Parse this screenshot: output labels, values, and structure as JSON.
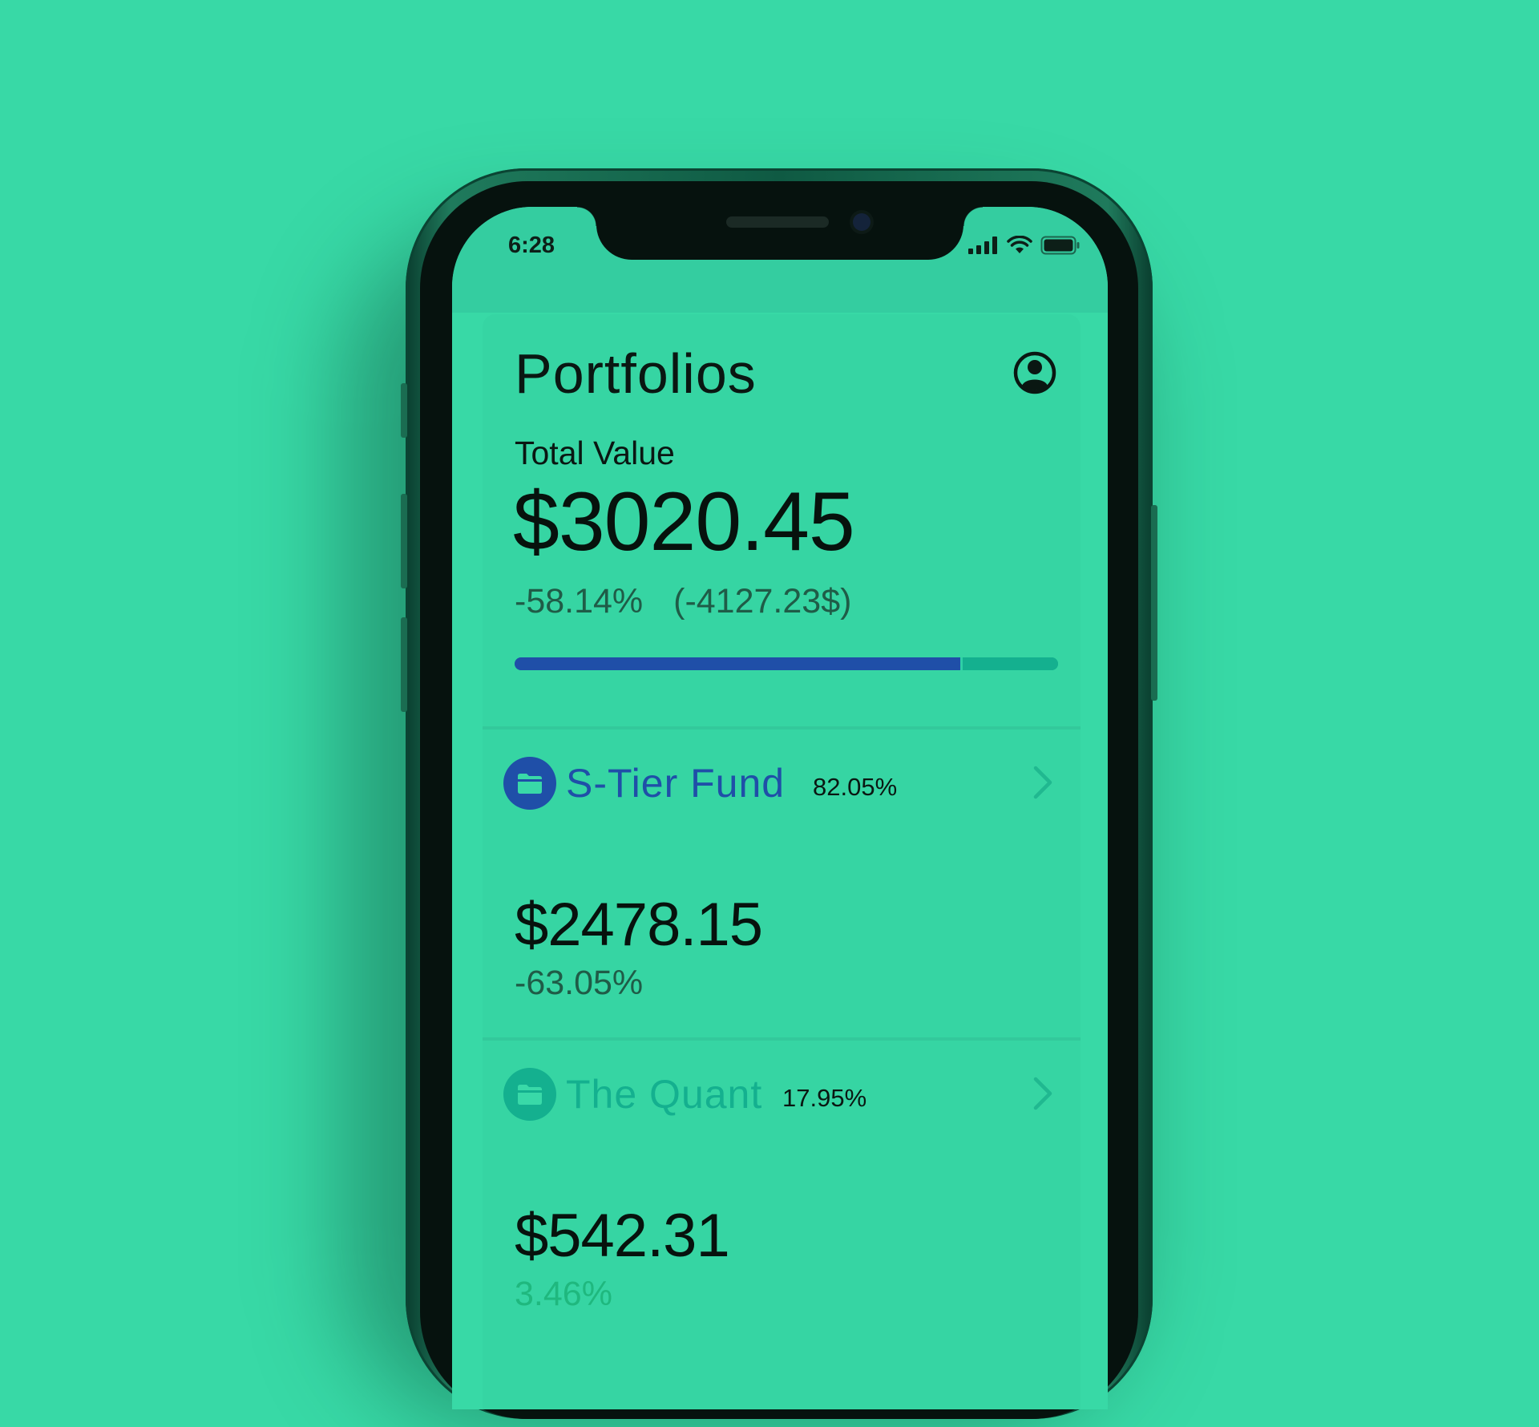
{
  "status_bar": {
    "time": "6:28"
  },
  "header": {
    "title": "Portfolios"
  },
  "summary": {
    "label": "Total Value",
    "value": "$3020.45",
    "change_percent": "-58.14%",
    "change_amount": "(-4127.23$)"
  },
  "allocation": {
    "segments": [
      82.05,
      17.95
    ]
  },
  "colors": {
    "background": "#38D9A6",
    "fund_primary": "#1F4FA8",
    "fund_secondary": "#14B08F",
    "negative_change": "#1f5c47",
    "positive_change": "#1FB87E"
  },
  "funds": [
    {
      "name": "S-Tier Fund",
      "allocation": "82.05%",
      "value": "$2478.15",
      "change": "-63.05%",
      "icon": "folder-icon",
      "color": "#1F4FA8"
    },
    {
      "name": "The Quant",
      "allocation": "17.95%",
      "value": "$542.31",
      "change": "3.46%",
      "icon": "folder-icon",
      "color": "#14B08F"
    }
  ]
}
